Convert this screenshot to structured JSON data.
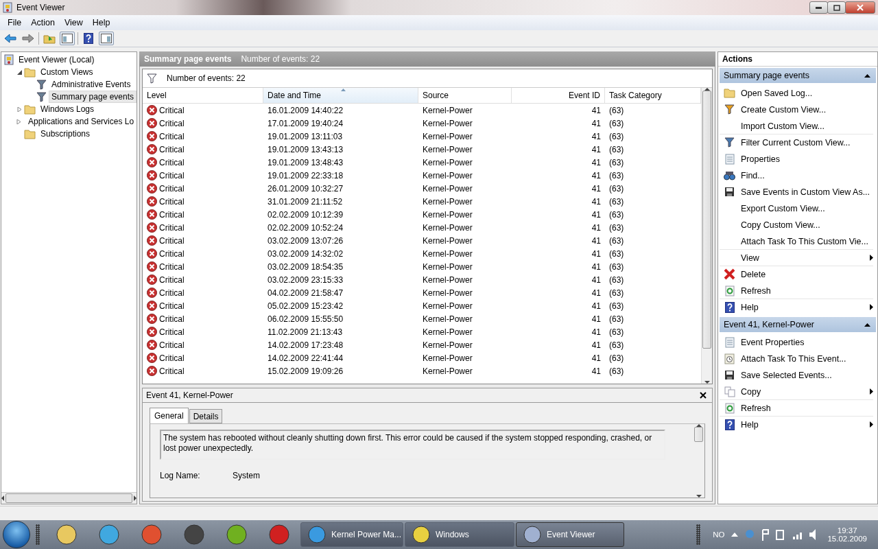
{
  "window": {
    "title": "Event Viewer"
  },
  "menu": [
    "File",
    "Action",
    "View",
    "Help"
  ],
  "tree": [
    {
      "label": "Event Viewer (Local)",
      "selected": false,
      "children": [
        {
          "label": "Custom Views",
          "selected": false,
          "expanded": true,
          "children": [
            {
              "label": "Administrative Events",
              "selected": false
            },
            {
              "label": "Summary page events",
              "selected": true
            }
          ]
        },
        {
          "label": "Windows Logs",
          "selected": false,
          "expanded": false
        },
        {
          "label": "Applications and Services Lo",
          "selected": false,
          "expanded": false
        },
        {
          "label": "Subscriptions",
          "selected": false
        }
      ]
    }
  ],
  "center": {
    "title": "Summary page events",
    "count": "Number of events: 22",
    "filter_text": "Number of events: 22"
  },
  "table": {
    "columns": [
      {
        "label": "Level",
        "sorted": false
      },
      {
        "label": "Date and Time",
        "sorted": true
      },
      {
        "label": "Source",
        "sorted": false
      },
      {
        "label": "Event ID",
        "sorted": false
      },
      {
        "label": "Task Category",
        "sorted": false
      }
    ],
    "rows": [
      {
        "level": "Critical",
        "date": "16.01.2009 14:40:22",
        "source": "Kernel-Power",
        "event_id": "41",
        "task_category": "(63)"
      },
      {
        "level": "Critical",
        "date": "17.01.2009 19:40:24",
        "source": "Kernel-Power",
        "event_id": "41",
        "task_category": "(63)"
      },
      {
        "level": "Critical",
        "date": "19.01.2009 13:11:03",
        "source": "Kernel-Power",
        "event_id": "41",
        "task_category": "(63)"
      },
      {
        "level": "Critical",
        "date": "19.01.2009 13:43:13",
        "source": "Kernel-Power",
        "event_id": "41",
        "task_category": "(63)"
      },
      {
        "level": "Critical",
        "date": "19.01.2009 13:48:43",
        "source": "Kernel-Power",
        "event_id": "41",
        "task_category": "(63)"
      },
      {
        "level": "Critical",
        "date": "19.01.2009 22:33:18",
        "source": "Kernel-Power",
        "event_id": "41",
        "task_category": "(63)"
      },
      {
        "level": "Critical",
        "date": "26.01.2009 10:32:27",
        "source": "Kernel-Power",
        "event_id": "41",
        "task_category": "(63)"
      },
      {
        "level": "Critical",
        "date": "31.01.2009 21:11:52",
        "source": "Kernel-Power",
        "event_id": "41",
        "task_category": "(63)"
      },
      {
        "level": "Critical",
        "date": "02.02.2009 10:12:39",
        "source": "Kernel-Power",
        "event_id": "41",
        "task_category": "(63)"
      },
      {
        "level": "Critical",
        "date": "02.02.2009 10:52:24",
        "source": "Kernel-Power",
        "event_id": "41",
        "task_category": "(63)"
      },
      {
        "level": "Critical",
        "date": "03.02.2009 13:07:26",
        "source": "Kernel-Power",
        "event_id": "41",
        "task_category": "(63)"
      },
      {
        "level": "Critical",
        "date": "03.02.2009 14:32:02",
        "source": "Kernel-Power",
        "event_id": "41",
        "task_category": "(63)"
      },
      {
        "level": "Critical",
        "date": "03.02.2009 18:54:35",
        "source": "Kernel-Power",
        "event_id": "41",
        "task_category": "(63)"
      },
      {
        "level": "Critical",
        "date": "03.02.2009 23:15:33",
        "source": "Kernel-Power",
        "event_id": "41",
        "task_category": "(63)"
      },
      {
        "level": "Critical",
        "date": "04.02.2009 21:58:47",
        "source": "Kernel-Power",
        "event_id": "41",
        "task_category": "(63)"
      },
      {
        "level": "Critical",
        "date": "05.02.2009 15:23:42",
        "source": "Kernel-Power",
        "event_id": "41",
        "task_category": "(63)"
      },
      {
        "level": "Critical",
        "date": "06.02.2009 15:55:50",
        "source": "Kernel-Power",
        "event_id": "41",
        "task_category": "(63)"
      },
      {
        "level": "Critical",
        "date": "11.02.2009 21:13:43",
        "source": "Kernel-Power",
        "event_id": "41",
        "task_category": "(63)"
      },
      {
        "level": "Critical",
        "date": "14.02.2009 17:23:48",
        "source": "Kernel-Power",
        "event_id": "41",
        "task_category": "(63)"
      },
      {
        "level": "Critical",
        "date": "14.02.2009 22:41:44",
        "source": "Kernel-Power",
        "event_id": "41",
        "task_category": "(63)"
      },
      {
        "level": "Critical",
        "date": "15.02.2009 19:09:26",
        "source": "Kernel-Power",
        "event_id": "41",
        "task_category": "(63)"
      }
    ]
  },
  "detail": {
    "title": "Event 41, Kernel-Power",
    "tabs": [
      {
        "label": "General",
        "selected": true
      },
      {
        "label": "Details",
        "selected": false
      }
    ],
    "message": "The system has rebooted without cleanly shutting down first. This error could be caused if the system stopped responding, crashed, or lost power unexpectedly.",
    "fields": [
      {
        "label": "Log Name:",
        "value": "System"
      }
    ]
  },
  "actions": {
    "title": "Actions",
    "sections": [
      {
        "title": "Summary page events",
        "expanded": true,
        "items": [
          {
            "label": "Open Saved Log...",
            "submenu": false,
            "divider": false
          },
          {
            "label": "Create Custom View...",
            "submenu": false,
            "divider": false
          },
          {
            "label": "Import Custom View...",
            "submenu": false,
            "divider": true
          },
          {
            "label": "Filter Current Custom View...",
            "submenu": false,
            "divider": false
          },
          {
            "label": "Properties",
            "submenu": false,
            "divider": false
          },
          {
            "label": "Find...",
            "submenu": false,
            "divider": false
          },
          {
            "label": "Save Events in Custom View As...",
            "submenu": false,
            "divider": false
          },
          {
            "label": "Export Custom View...",
            "submenu": false,
            "divider": false
          },
          {
            "label": "Copy Custom View...",
            "submenu": false,
            "divider": false
          },
          {
            "label": "Attach Task To This Custom Vie...",
            "submenu": false,
            "divider": true
          },
          {
            "label": "View",
            "submenu": true,
            "divider": true
          },
          {
            "label": "Delete",
            "submenu": false,
            "divider": false
          },
          {
            "label": "Refresh",
            "submenu": false,
            "divider": true
          },
          {
            "label": "Help",
            "submenu": true,
            "divider": false
          }
        ]
      },
      {
        "title": "Event 41, Kernel-Power",
        "expanded": true,
        "items": [
          {
            "label": "Event Properties",
            "submenu": false,
            "divider": false
          },
          {
            "label": "Attach Task To This Event...",
            "submenu": false,
            "divider": false
          },
          {
            "label": "Save Selected Events...",
            "submenu": false,
            "divider": false
          },
          {
            "label": "Copy",
            "submenu": true,
            "divider": true
          },
          {
            "label": "Refresh",
            "submenu": false,
            "divider": true
          },
          {
            "label": "Help",
            "submenu": true,
            "divider": false
          }
        ]
      }
    ]
  },
  "taskbar": {
    "tasks": [
      {
        "label": "Kernel Power Ma...",
        "selected": false
      },
      {
        "label": "Windows",
        "selected": false
      },
      {
        "label": "Event Viewer",
        "selected": true
      }
    ],
    "language": "NO",
    "time": "19:37",
    "date": "15.02.2009"
  }
}
